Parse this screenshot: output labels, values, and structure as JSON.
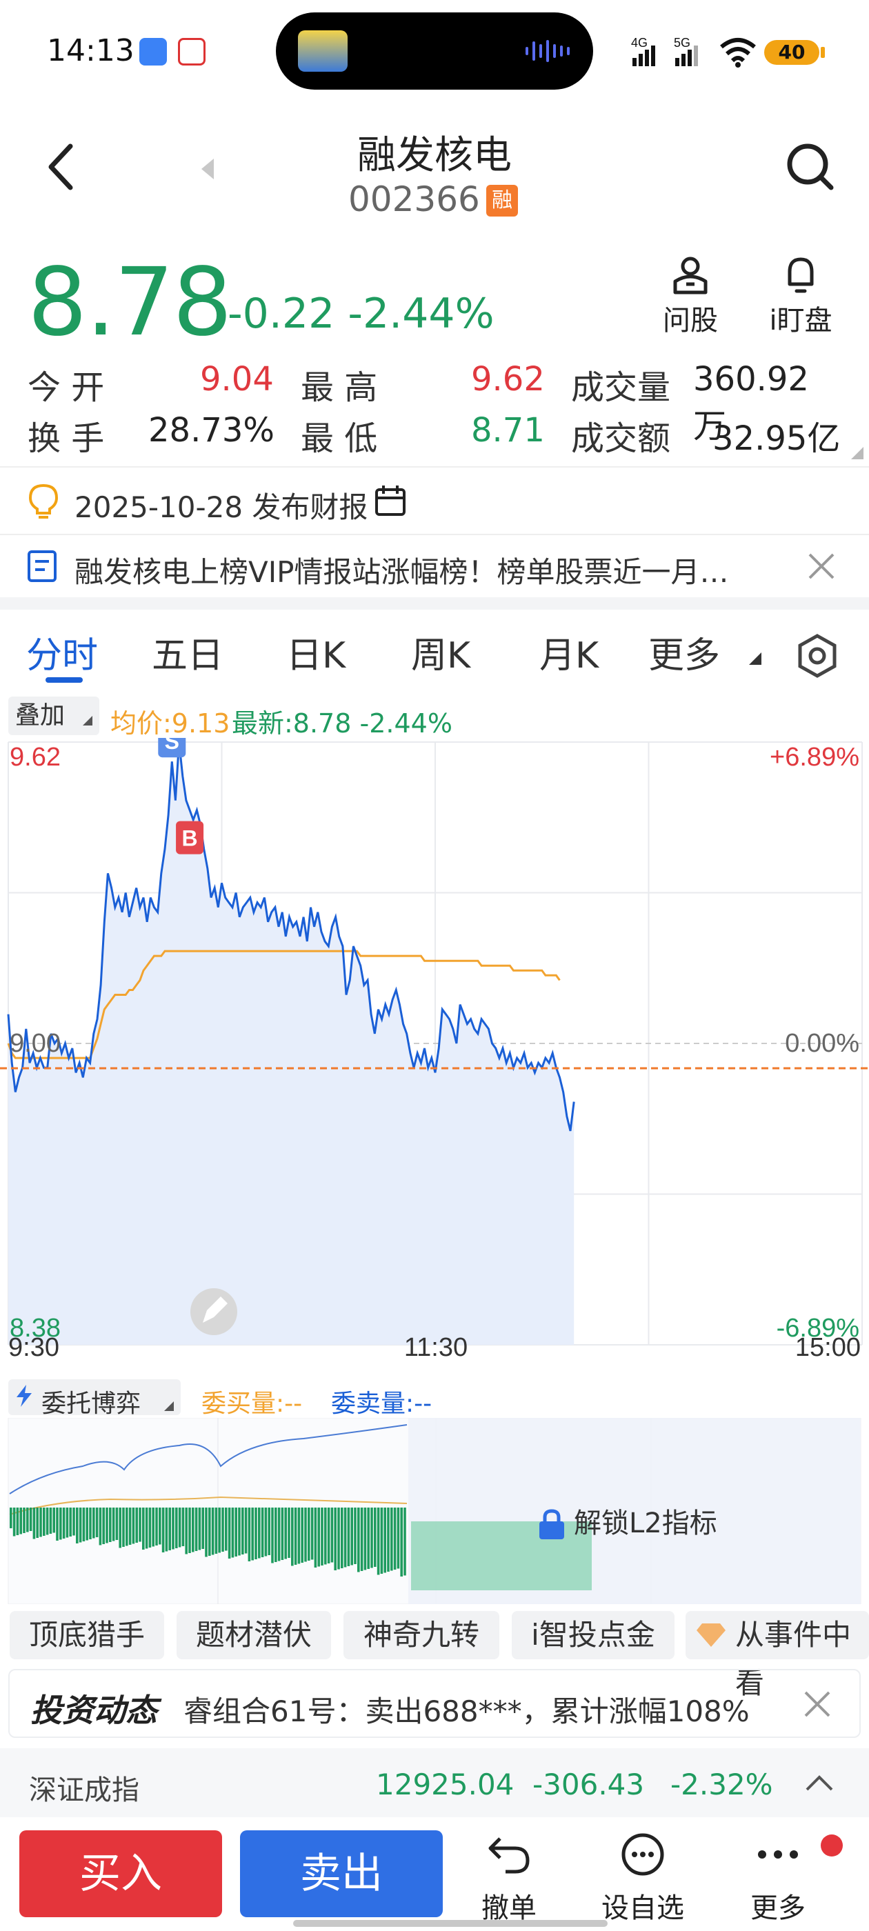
{
  "status_bar": {
    "time": "14:13",
    "network": "4G 5G",
    "battery": "40"
  },
  "header": {
    "stock_name": "融发核电",
    "stock_code": "002366",
    "margin_badge": "融",
    "ask_label": "问股",
    "watch_label": "i盯盘"
  },
  "quote": {
    "price": "8.78",
    "change": "-0.22",
    "change_pct": "-2.44%",
    "stats": [
      {
        "label": "今 开",
        "value": "9.04",
        "label2": "最 高",
        "value2": "9.62",
        "label3": "成交量",
        "value3": "360.92万"
      },
      {
        "label": "换 手",
        "value": "28.73%",
        "label2": "最 低",
        "value2": "8.71",
        "label3": "成交额",
        "value3": "32.95亿"
      }
    ]
  },
  "report": {
    "text": "2025-10-28 发布财报"
  },
  "news": {
    "text": "融发核电上榜VIP情报站涨幅榜！榜单股票近一月…"
  },
  "tabs": [
    "分时",
    "五日",
    "日K",
    "周K",
    "月K",
    "更多"
  ],
  "overlay": {
    "label": "叠加",
    "avg_label": "均价:9.13",
    "latest_label": "最新:8.78 -2.44%"
  },
  "chart_data": {
    "type": "line",
    "y_left_labels": [
      "9.62",
      "9.00",
      "8.38"
    ],
    "y_right_labels": [
      "+6.89%",
      "0.00%",
      "-6.89%"
    ],
    "x_labels": [
      "9:30",
      "11:30",
      "15:00"
    ],
    "ylim": [
      8.38,
      9.62
    ],
    "prev_close": 9.0,
    "markers": [
      {
        "label": "S",
        "color": "#5b8de8"
      },
      {
        "label": "B",
        "color": "#e4474d"
      }
    ],
    "series": [
      {
        "name": "最新",
        "color": "#1a5fd6",
        "values": [
          9.06,
          8.96,
          8.9,
          8.93,
          8.95,
          9.03,
          8.96,
          8.98,
          8.95,
          8.97,
          8.95,
          8.95,
          9.02,
          9.0,
          9.01,
          8.98,
          9.0,
          8.97,
          8.99,
          8.94,
          8.96,
          8.93,
          8.97,
          8.96,
          9.02,
          9.05,
          9.12,
          9.25,
          9.35,
          9.32,
          9.28,
          9.3,
          9.27,
          9.31,
          9.26,
          9.29,
          9.32,
          9.28,
          9.3,
          9.25,
          9.3,
          9.28,
          9.27,
          9.35,
          9.4,
          9.47,
          9.58,
          9.5,
          9.62,
          9.55,
          9.5,
          9.48,
          9.46,
          9.48,
          9.45,
          9.4,
          9.36,
          9.3,
          9.32,
          9.28,
          9.33,
          9.3,
          9.29,
          9.28,
          9.31,
          9.26,
          9.28,
          9.29,
          9.3,
          9.27,
          9.29,
          9.28,
          9.3,
          9.25,
          9.27,
          9.28,
          9.24,
          9.27,
          9.22,
          9.26,
          9.24,
          9.25,
          9.22,
          9.26,
          9.21,
          9.28,
          9.24,
          9.27,
          9.23,
          9.21,
          9.2,
          9.24,
          9.26,
          9.22,
          9.2,
          9.1,
          9.13,
          9.2,
          9.18,
          9.16,
          9.12,
          9.13,
          9.06,
          9.02,
          9.07,
          9.05,
          9.08,
          9.06,
          9.09,
          9.11,
          9.08,
          9.04,
          9.02,
          8.98,
          8.95,
          8.98,
          8.96,
          8.99,
          8.95,
          8.97,
          8.94,
          8.99,
          9.07,
          9.06,
          9.05,
          9.03,
          9.0,
          9.08,
          9.06,
          9.04,
          9.05,
          9.03,
          9.02,
          9.05,
          9.04,
          9.03,
          9.0,
          8.99,
          8.97,
          8.99,
          8.96,
          8.98,
          8.95,
          8.97,
          8.96,
          8.98,
          8.95,
          8.96,
          8.94,
          8.96,
          8.95,
          8.97,
          8.96,
          8.98,
          8.95,
          8.93,
          8.9,
          8.85,
          8.82,
          8.88
        ]
      },
      {
        "name": "均价",
        "color": "#f2a32f",
        "values": [
          9.0,
          8.98,
          8.97,
          8.97,
          8.97,
          8.97,
          8.97,
          8.97,
          8.97,
          8.97,
          8.97,
          8.97,
          8.97,
          8.97,
          8.97,
          8.97,
          8.97,
          8.97,
          8.97,
          8.97,
          8.97,
          8.97,
          8.97,
          8.97,
          8.99,
          9.01,
          9.04,
          9.07,
          9.08,
          9.09,
          9.1,
          9.1,
          9.1,
          9.1,
          9.11,
          9.11,
          9.12,
          9.13,
          9.15,
          9.16,
          9.17,
          9.18,
          9.18,
          9.18,
          9.19,
          9.19,
          9.19,
          9.19,
          9.19,
          9.19,
          9.19,
          9.19,
          9.19,
          9.19,
          9.19,
          9.19,
          9.19,
          9.19,
          9.19,
          9.19,
          9.19,
          9.19,
          9.19,
          9.19,
          9.19,
          9.19,
          9.19,
          9.19,
          9.19,
          9.19,
          9.19,
          9.19,
          9.19,
          9.19,
          9.19,
          9.19,
          9.19,
          9.19,
          9.19,
          9.19,
          9.19,
          9.19,
          9.19,
          9.19,
          9.19,
          9.19,
          9.19,
          9.19,
          9.19,
          9.19,
          9.19,
          9.19,
          9.19,
          9.19,
          9.19,
          9.19,
          9.19,
          9.19,
          9.19,
          9.18,
          9.18,
          9.18,
          9.18,
          9.18,
          9.18,
          9.18,
          9.18,
          9.18,
          9.18,
          9.18,
          9.18,
          9.18,
          9.18,
          9.18,
          9.18,
          9.18,
          9.18,
          9.17,
          9.17,
          9.17,
          9.17,
          9.17,
          9.17,
          9.17,
          9.17,
          9.17,
          9.17,
          9.17,
          9.17,
          9.17,
          9.17,
          9.17,
          9.17,
          9.16,
          9.16,
          9.16,
          9.16,
          9.16,
          9.16,
          9.16,
          9.16,
          9.16,
          9.15,
          9.15,
          9.15,
          9.15,
          9.15,
          9.15,
          9.15,
          9.15,
          9.15,
          9.14,
          9.14,
          9.14,
          9.14,
          9.13
        ]
      }
    ],
    "total_points": 241
  },
  "depth": {
    "title": "委托博弈",
    "buy_label": "委买量:--",
    "sell_label": "委卖量:--",
    "unlock_label": "解锁L2指标"
  },
  "tools": [
    "顶底猎手",
    "题材潜伏",
    "神奇九转",
    "i智投点金",
    "从事件中看"
  ],
  "invest": {
    "logo": "投资动态",
    "text": "睿组合61号：卖出688***，累计涨幅108%"
  },
  "index": {
    "name": "深证成指",
    "value": "12925.04",
    "change": "-306.43",
    "pct": "-2.32%"
  },
  "bottom_bar": {
    "buy": "买入",
    "sell": "卖出",
    "cancel": "撤单",
    "watchlist": "设自选",
    "more": "更多"
  },
  "colors": {
    "up": "#e0383e",
    "down": "#1f9b5f",
    "accent": "#1a5fd6"
  }
}
